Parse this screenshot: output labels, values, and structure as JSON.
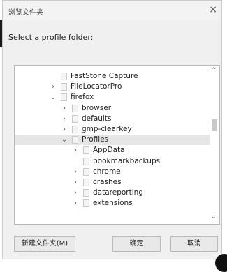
{
  "dialog": {
    "title": "浏览文件夹",
    "close_glyph": "×",
    "prompt": "Select a profile folder:"
  },
  "tree": {
    "items": [
      {
        "label": "FastStone Capture",
        "depth": 1,
        "expander": ""
      },
      {
        "label": "FileLocatorPro",
        "depth": 1,
        "expander": "›"
      },
      {
        "label": "firefox",
        "depth": 1,
        "expander": "⌄"
      },
      {
        "label": "browser",
        "depth": 2,
        "expander": "›"
      },
      {
        "label": "defaults",
        "depth": 2,
        "expander": "›"
      },
      {
        "label": "gmp-clearkey",
        "depth": 2,
        "expander": "›"
      },
      {
        "label": "Profiles",
        "depth": 2,
        "expander": "⌄",
        "selected": true
      },
      {
        "label": "AppData",
        "depth": 3,
        "expander": "›"
      },
      {
        "label": "bookmarkbackups",
        "depth": 3,
        "expander": ""
      },
      {
        "label": "chrome",
        "depth": 3,
        "expander": "›"
      },
      {
        "label": "crashes",
        "depth": 3,
        "expander": "›"
      },
      {
        "label": "datareporting",
        "depth": 3,
        "expander": "›"
      },
      {
        "label": "extensions",
        "depth": 3,
        "expander": "›"
      }
    ],
    "scroll_up_glyph": "^",
    "scroll_down_glyph": "⌄"
  },
  "buttons": {
    "new_folder": "新建文件夹(M)",
    "ok": "确定",
    "cancel": "取消"
  },
  "colors": {
    "dialog_bg": "#f0f0f0",
    "selected_row": "#e6e6e6"
  }
}
